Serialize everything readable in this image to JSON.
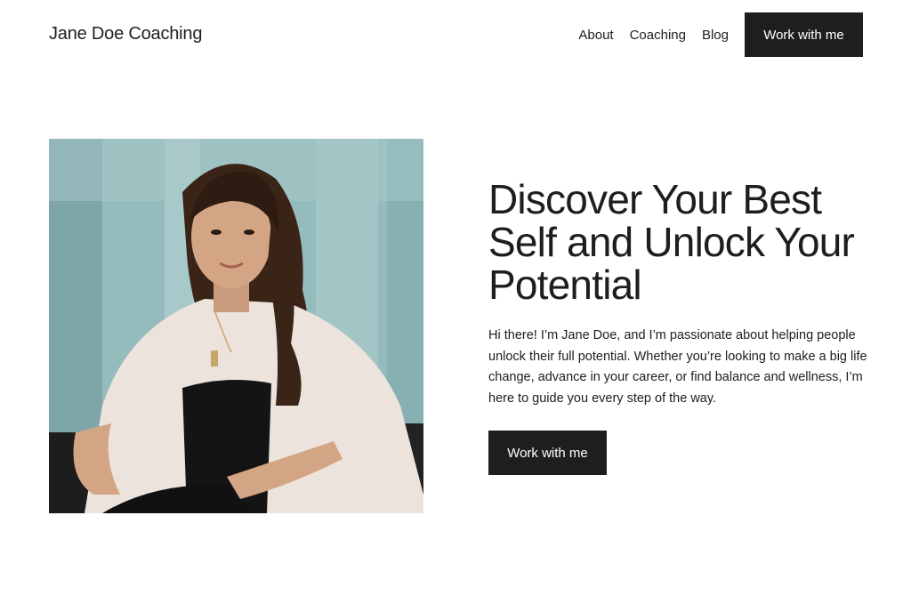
{
  "header": {
    "site_title": "Jane Doe Coaching",
    "nav": [
      {
        "label": "About"
      },
      {
        "label": "Coaching"
      },
      {
        "label": "Blog"
      }
    ],
    "cta_label": "Work with me"
  },
  "hero": {
    "heading": "Discover Your Best Self and Unlock Your Potential",
    "body": "Hi there! I’m Jane Doe, and I’m passionate about helping people unlock their full potential. Whether you’re looking to make a big life change, advance in your career, or find balance and wellness, I’m here to guide you every step of the way.",
    "cta_label": "Work with me"
  },
  "colors": {
    "text": "#1e1e1e",
    "button_bg": "#1e1e1e",
    "button_text": "#ffffff",
    "background": "#ffffff"
  }
}
